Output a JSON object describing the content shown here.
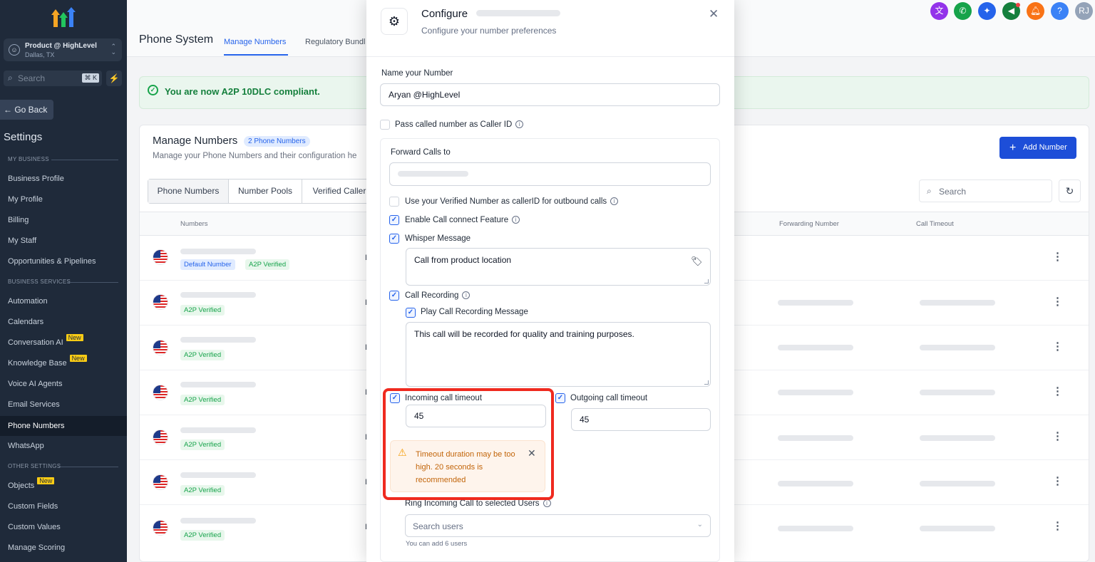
{
  "sidebar": {
    "location_name": "Product @ HighLevel",
    "location_city": "Dallas, TX",
    "search_placeholder": "Search",
    "search_shortcut": "⌘ K",
    "go_back": "← Go Back",
    "settings_title": "Settings",
    "section_my_business": "MY BUSINESS",
    "section_business_services": "BUSINESS SERVICES",
    "section_other_settings": "OTHER SETTINGS",
    "new_badge": "New",
    "items": {
      "business_profile": "Business Profile",
      "my_profile": "My Profile",
      "billing": "Billing",
      "my_staff": "My Staff",
      "opportunities": "Opportunities & Pipelines",
      "automation": "Automation",
      "calendars": "Calendars",
      "conversation_ai": "Conversation AI",
      "knowledge_base": "Knowledge Base",
      "voice_ai": "Voice AI Agents",
      "email_services": "Email Services",
      "phone_numbers": "Phone Numbers",
      "whatsapp": "WhatsApp",
      "objects": "Objects",
      "custom_fields": "Custom Fields",
      "custom_values": "Custom Values",
      "manage_scoring": "Manage Scoring"
    }
  },
  "header": {
    "title": "Phone System",
    "tab_manage_numbers": "Manage Numbers",
    "tab_regulatory": "Regulatory Bundl",
    "avatar_initials": "RJ",
    "help_glyph": "?"
  },
  "banner": {
    "text": "You are now A2P 10DLC compliant."
  },
  "manage": {
    "title": "Manage Numbers",
    "count_badge": "2 Phone Numbers",
    "subtitle": "Manage your Phone Numbers and their configuration he",
    "add_button": "Add Number",
    "tabs": [
      "Phone Numbers",
      "Number Pools",
      "Verified Caller"
    ],
    "search_placeholder": "Search",
    "columns": {
      "numbers": "Numbers",
      "forwarding": "Forwarding Number",
      "timeout": "Call Timeout"
    },
    "default_badge": "Default Number",
    "verified_badge": "A2P Verified",
    "row_partial": "L"
  },
  "modal": {
    "title": "Configure",
    "subtitle": "Configure your number preferences",
    "name_label": "Name your Number",
    "name_value": "Aryan @HighLevel",
    "pass_caller_id": "Pass called number as Caller ID",
    "forward_label": "Forward Calls to",
    "use_verified": "Use your Verified Number as callerID for outbound calls",
    "enable_call_connect": "Enable Call connect Feature",
    "whisper_label": "Whisper Message",
    "whisper_value": "Call from product location",
    "call_recording": "Call Recording",
    "play_recording_msg": "Play Call Recording Message",
    "recording_msg_value": "This call will be recorded for quality and training purposes.",
    "incoming_timeout_label": "Incoming call timeout",
    "incoming_timeout_value": "45",
    "outgoing_timeout_label": "Outgoing call timeout",
    "outgoing_timeout_value": "45",
    "warning_text": "Timeout duration may be too high. 20 seconds is recommended",
    "ring_users_label": "Ring Incoming Call to selected Users",
    "search_users_placeholder": "Search users",
    "users_hint": "You can add 6 users"
  },
  "colors": {
    "accent": "#2563eb",
    "warning": "#c2650a",
    "highlight": "#ef2a1f",
    "success": "#15803d"
  }
}
